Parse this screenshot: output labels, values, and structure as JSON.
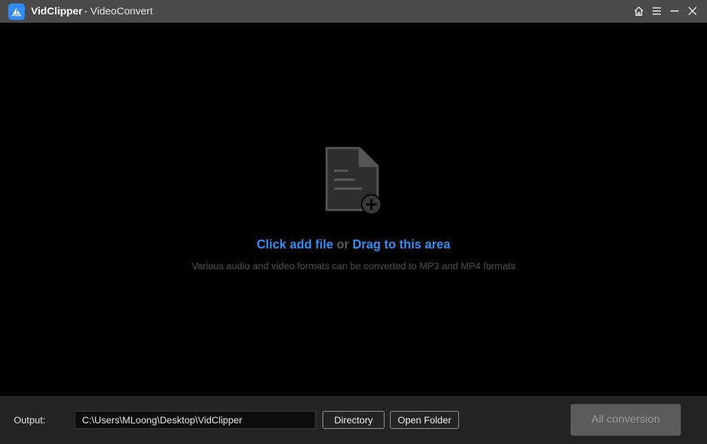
{
  "titlebar": {
    "app_name": "VidClipper",
    "subtitle": "- VideoConvert",
    "icons": {
      "logo": "app-logo-icon",
      "home": "home-icon",
      "menu": "menu-icon",
      "minimize": "minimize-icon",
      "close": "close-icon"
    }
  },
  "drop_area": {
    "icon": "add-file-icon",
    "click_label": "Click add file",
    "or_label": "or",
    "drag_label": "Drag to this area",
    "hint": "Various audio and video formats can be converted to MP3 and MP4 formats"
  },
  "bottombar": {
    "output_label": "Output:",
    "output_path": "C:\\Users\\MLoong\\Desktop\\VidClipper",
    "directory_label": "Directory",
    "open_folder_label": "Open Folder",
    "all_conversion_label": "All conversion"
  },
  "colors": {
    "accent": "#2c8ff4",
    "titlebar_bg": "#4a4a4a",
    "bottombar_bg": "#242424",
    "disabled_button_bg": "#5b5b5b"
  }
}
